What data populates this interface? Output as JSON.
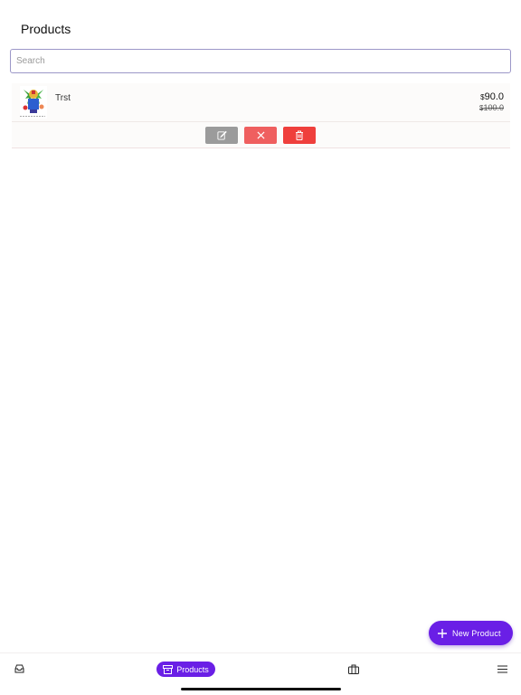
{
  "page": {
    "title": "Products"
  },
  "search": {
    "placeholder": "Search"
  },
  "products": [
    {
      "name": "Trst",
      "price_currency": "$",
      "price": "90.0",
      "old_price_currency": "$",
      "old_price": "100.0"
    }
  ],
  "actions": {
    "edit_icon": "edit-icon",
    "cancel_icon": "close-icon",
    "delete_icon": "trash-icon"
  },
  "fab": {
    "label": "New Product",
    "icon": "plus-icon"
  },
  "tabbar": {
    "items": [
      {
        "icon": "inbox-icon"
      },
      {
        "icon": "archive-box-icon",
        "label": "Products"
      },
      {
        "icon": "briefcase-icon"
      },
      {
        "icon": "menu-icon"
      }
    ]
  },
  "colors": {
    "accent": "#6a1fe6",
    "edit_button": "#9b9b9b",
    "cancel_button": "#ef5f5f",
    "delete_button": "#ef3f3c",
    "search_border": "#9c97c8"
  }
}
